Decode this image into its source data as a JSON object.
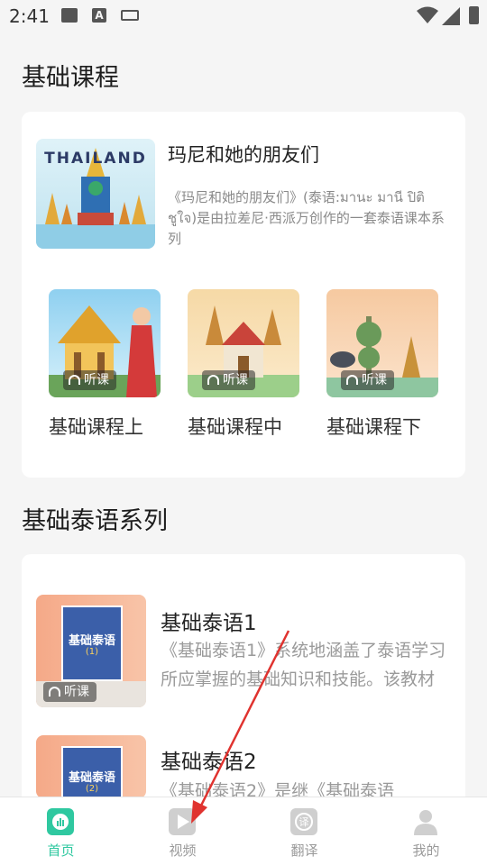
{
  "status": {
    "time": "2:41"
  },
  "sections": {
    "basic_course": "基础课程",
    "basic_thai_series": "基础泰语系列"
  },
  "hero": {
    "image_text": "THAILAND",
    "title": "玛尼和她的朋友们",
    "desc": "《玛尼和她的朋友们》(泰语:มานะ มานี ปิติ ชูใจ)是由拉差尼·西派万创作的一套泰语课本系列"
  },
  "listen_label": "听课",
  "courses": [
    {
      "label": "基础课程上"
    },
    {
      "label": "基础课程中"
    },
    {
      "label": "基础课程下"
    }
  ],
  "books": [
    {
      "title": "基础泰语1",
      "cover_text": "基础泰语",
      "cover_num": "(1)",
      "desc": "《基础泰语1》系统地涵盖了泰语学习所应掌握的基础知识和技能。该教材"
    },
    {
      "title": "基础泰语2",
      "cover_text": "基础泰语",
      "cover_num": "(2)",
      "desc": "《基础泰语2》是继《基础泰语"
    }
  ],
  "tabs": [
    {
      "label": "首页",
      "icon": "chart-icon",
      "active": true
    },
    {
      "label": "视频",
      "icon": "play-icon",
      "active": false
    },
    {
      "label": "翻译",
      "icon": "translate-icon",
      "active": false
    },
    {
      "label": "我的",
      "icon": "person-icon",
      "active": false
    }
  ],
  "colors": {
    "accent": "#2fc8a0",
    "arrow": "#e0332f"
  }
}
